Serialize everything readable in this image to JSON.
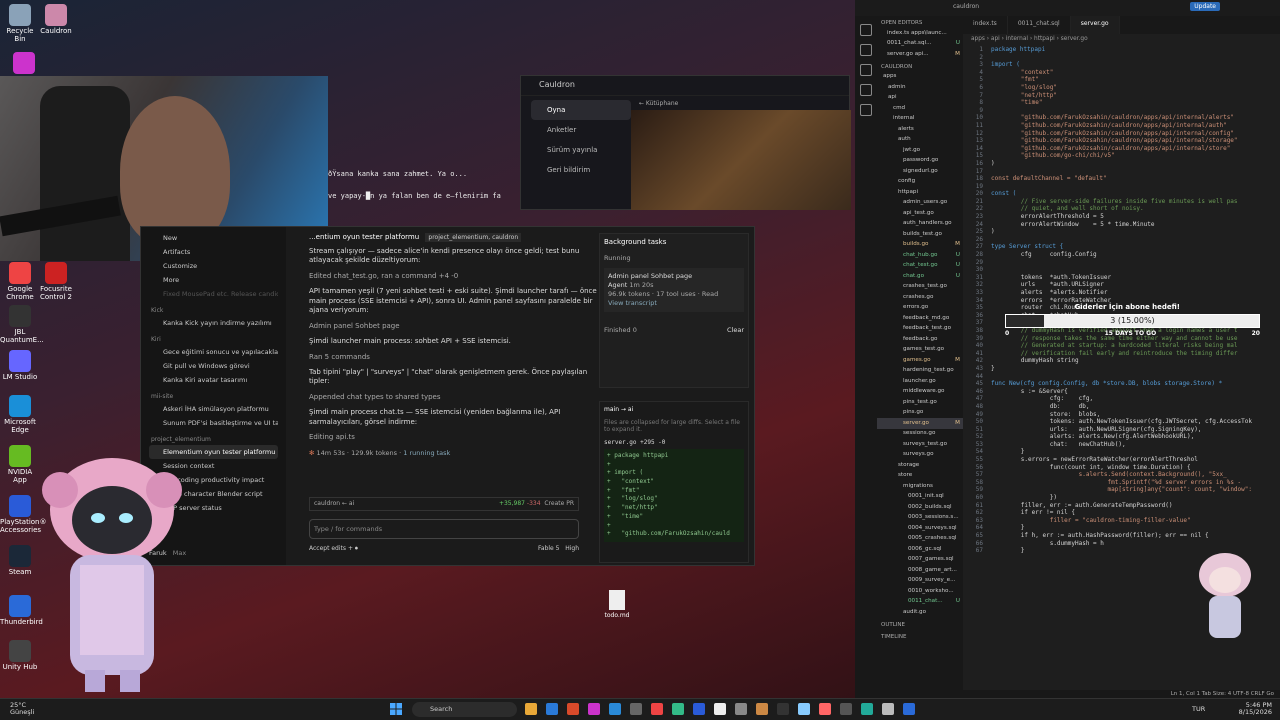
{
  "desktop": {
    "icons": [
      {
        "label": "Recycle Bin",
        "color": "#8aa2b8"
      },
      {
        "label": "Cauldron",
        "color": "#c8a"
      },
      {
        "label": "Google Chrome",
        "color": "#e44"
      },
      {
        "label": "Focusrite Control 2",
        "color": "#c22"
      },
      {
        "label": "JBL QuantumE...",
        "color": "#333"
      },
      {
        "label": "LM Studio",
        "color": "#66f"
      },
      {
        "label": "Microsoft Edge",
        "color": "#1a8fd8"
      },
      {
        "label": "NVIDIA App",
        "color": "#6b2"
      },
      {
        "label": "PlayStation® Accessories",
        "color": "#2a5bd8"
      },
      {
        "label": "Steam",
        "color": "#1b2838"
      },
      {
        "label": "Thunderbird",
        "color": "#2a6ad8"
      },
      {
        "label": "Unity Hub",
        "color": "#444"
      }
    ],
    "file_label": "todo.md"
  },
  "launcher": {
    "title": "Cauldron",
    "nav": [
      "Oyna",
      "Anketler",
      "Sürüm yayınla",
      "Geri bildirim"
    ],
    "breadcrumb": "← Kütüphane"
  },
  "terminal": {
    "line1": "ðŸsana kanka sana zahmet. Ya o...",
    "line2": "ve yapay-█n ya falan ben de e—flenirim fa"
  },
  "claude": {
    "sidebar": {
      "top_items": [
        "New",
        "Artifacts",
        "Customize",
        "More"
      ],
      "faded": "Fixed MousePad etc. Release candidate",
      "sections": [
        {
          "title": "Kick",
          "items": [
            "Kanka Kick yayın indirme yazılımı"
          ]
        },
        {
          "title": "Kiri",
          "items": [
            "Gece eğitimi sonucu ve yapılacaklar",
            "Git pull ve Windows görevi",
            "Kanka Kiri avatar tasarımı"
          ]
        },
        {
          "title": "mii-site",
          "items": [
            "Askeri İHA simülasyon platformu",
            "Sunum PDF'si basitleştirme ve UI ta..."
          ]
        },
        {
          "title": "project_elementium",
          "items": [
            "Elementium oyun tester platformu",
            "Session context",
            "Vibecoding productivity impact",
            "MOSS character Blender script",
            "MCP server status"
          ]
        }
      ],
      "user": "Faruk",
      "plan": "Max"
    },
    "chat": {
      "title": "...entium oyun tester platformu",
      "project_tag": "project_elementium, cauldron",
      "p1": "Stream çalışıyor — sadece alice'in kendi presence olayı önce geldi; test bunu atlayacak şekilde düzeltiyorum:",
      "m1": "Edited chat_test.go, ran a command +4 -0",
      "p2": "API tamamen yeşil (7 yeni sohbet testi + eski suite). Şimdi launcher tarafı — önce main process (SSE istemcisi + API), sonra UI. Admin panel sayfasını paralelde bir ajana veriyorum:",
      "m2": "Admin panel Sohbet page",
      "p3": "Şimdi launcher main process: sohbet API + SSE istemcisi.",
      "m3": "Ran 5 commands",
      "p4": "Tab tipini \"play\" | \"surveys\" | \"chat\" olarak genişletmem gerek. Önce paylaşılan tipler:",
      "m4": "Appended chat types to shared types",
      "p5": "Şimdi main process chat.ts — SSE istemcisi (yeniden bağlanma ile), API sarmalayıcıları, görsel indirme:",
      "m5": "Editing api.ts",
      "stats_time": "14m 53s",
      "stats_tokens": "129.9k tokens",
      "stats_task": "1 running task"
    },
    "input": {
      "branch": "cauldron",
      "sub": "ai",
      "added": "+35,987",
      "removed": "-334",
      "pr": "Create PR",
      "placeholder": "Type / for commands",
      "accept": "Accept edits",
      "model": "Fable 5",
      "effort": "High"
    },
    "tasks": {
      "title": "Background tasks",
      "running": "Running",
      "task_name": "Admin panel Sohbet page",
      "agent": "Agent",
      "duration": "1m 20s",
      "usage": "96.9k tokens · 17 tool uses · Read",
      "transcript": "View transcript",
      "finished": "Finished 0",
      "clear": "Clear"
    },
    "diff": {
      "branch": "main",
      "arrow": "→ ai",
      "note": "Files are collapsed for large diffs. Select a file to expand it.",
      "file": "server.go +295 -0",
      "code": "+ package httpapi\n+\n+ import (\n+   \"context\"\n+   \"fmt\"\n+   \"log/slog\"\n+   \"net/http\"\n+   \"time\"\n+\n+   \"github.com/FarukOzsahin/cauld"
    }
  },
  "vscode": {
    "title": "cauldron",
    "update": "Update",
    "tabs": [
      "index.ts",
      "0011_chat.sql",
      "server.go"
    ],
    "breadcrumb": "apps › api › internal › httpapi › server.go",
    "explorer": {
      "open_editors": "OPEN EDITORS",
      "open_files": [
        {
          "name": "index.ts apps\\launc...",
          "flag": ""
        },
        {
          "name": "0011_chat.sql...",
          "flag": "U"
        },
        {
          "name": "server.go api...",
          "flag": "M"
        }
      ],
      "root": "CAULDRON",
      "tree": [
        {
          "name": "apps",
          "flag": "",
          "depth": 0
        },
        {
          "name": "admin",
          "flag": "",
          "depth": 1
        },
        {
          "name": "api",
          "flag": "",
          "depth": 1
        },
        {
          "name": "cmd",
          "flag": "",
          "depth": 2
        },
        {
          "name": "internal",
          "flag": "",
          "depth": 2
        },
        {
          "name": "alerts",
          "flag": "",
          "depth": 3
        },
        {
          "name": "auth",
          "flag": "",
          "depth": 3
        },
        {
          "name": "jwt.go",
          "flag": "",
          "depth": 4
        },
        {
          "name": "password.go",
          "flag": "",
          "depth": 4
        },
        {
          "name": "signedurl.go",
          "flag": "",
          "depth": 4
        },
        {
          "name": "config",
          "flag": "",
          "depth": 3
        },
        {
          "name": "httpapi",
          "flag": "",
          "depth": 3
        },
        {
          "name": "admin_users.go",
          "flag": "",
          "depth": 4
        },
        {
          "name": "api_test.go",
          "flag": "",
          "depth": 4
        },
        {
          "name": "auth_handlers.go",
          "flag": "",
          "depth": 4
        },
        {
          "name": "builds_test.go",
          "flag": "",
          "depth": 4
        },
        {
          "name": "builds.go",
          "flag": "M",
          "depth": 4
        },
        {
          "name": "chat_hub.go",
          "flag": "U",
          "depth": 4
        },
        {
          "name": "chat_test.go",
          "flag": "U",
          "depth": 4
        },
        {
          "name": "chat.go",
          "flag": "U",
          "depth": 4
        },
        {
          "name": "crashes_test.go",
          "flag": "",
          "depth": 4
        },
        {
          "name": "crashes.go",
          "flag": "",
          "depth": 4
        },
        {
          "name": "errors.go",
          "flag": "",
          "depth": 4
        },
        {
          "name": "feedback_md.go",
          "flag": "",
          "depth": 4
        },
        {
          "name": "feedback_test.go",
          "flag": "",
          "depth": 4
        },
        {
          "name": "feedback.go",
          "flag": "",
          "depth": 4
        },
        {
          "name": "games_test.go",
          "flag": "",
          "depth": 4
        },
        {
          "name": "games.go",
          "flag": "M",
          "depth": 4
        },
        {
          "name": "hardening_test.go",
          "flag": "",
          "depth": 4
        },
        {
          "name": "launcher.go",
          "flag": "",
          "depth": 4
        },
        {
          "name": "middleware.go",
          "flag": "",
          "depth": 4
        },
        {
          "name": "pins_test.go",
          "flag": "",
          "depth": 4
        },
        {
          "name": "pins.go",
          "flag": "",
          "depth": 4
        },
        {
          "name": "server.go",
          "flag": "M",
          "depth": 4
        },
        {
          "name": "sessions.go",
          "flag": "",
          "depth": 4
        },
        {
          "name": "surveys_test.go",
          "flag": "",
          "depth": 4
        },
        {
          "name": "surveys.go",
          "flag": "",
          "depth": 4
        },
        {
          "name": "storage",
          "flag": "",
          "depth": 3
        },
        {
          "name": "store",
          "flag": "",
          "depth": 3
        },
        {
          "name": "migrations",
          "flag": "",
          "depth": 4
        },
        {
          "name": "0001_init.sql",
          "flag": "",
          "depth": 5
        },
        {
          "name": "0002_builds.sql",
          "flag": "",
          "depth": 5
        },
        {
          "name": "0003_sessions.s...",
          "flag": "",
          "depth": 5
        },
        {
          "name": "0004_surveys.sql",
          "flag": "",
          "depth": 5
        },
        {
          "name": "0005_crashes.sql",
          "flag": "",
          "depth": 5
        },
        {
          "name": "0006_gc.sql",
          "flag": "",
          "depth": 5
        },
        {
          "name": "0007_games.sql",
          "flag": "",
          "depth": 5
        },
        {
          "name": "0008_game_art...",
          "flag": "",
          "depth": 5
        },
        {
          "name": "0009_survey_e...",
          "flag": "",
          "depth": 5
        },
        {
          "name": "0010_worksho...",
          "flag": "",
          "depth": 5
        },
        {
          "name": "0011_chat...",
          "flag": "U",
          "depth": 5
        },
        {
          "name": "audit.go",
          "flag": "",
          "depth": 4
        }
      ],
      "outline": "OUTLINE",
      "timeline": "TIMELINE"
    },
    "code": [
      "package httpapi",
      "",
      "import (",
      "\t\"context\"",
      "\t\"fmt\"",
      "\t\"log/slog\"",
      "\t\"net/http\"",
      "\t\"time\"",
      "",
      "\t\"github.com/FarukOzsahin/cauldron/apps/api/internal/alerts\"",
      "\t\"github.com/FarukOzsahin/cauldron/apps/api/internal/auth\"",
      "\t\"github.com/FarukOzsahin/cauldron/apps/api/internal/config\"",
      "\t\"github.com/FarukOzsahin/cauldron/apps/api/internal/storage\"",
      "\t\"github.com/FarukOzsahin/cauldron/apps/api/internal/store\"",
      "\t\"github.com/go-chi/chi/v5\"",
      ")",
      "",
      "const defaultChannel = \"default\"",
      "",
      "const (",
      "\t// Five server-side failures inside five minutes is well pas",
      "\t// quiet, and well short of noisy.",
      "\terrorAlertThreshold = 5",
      "\terrorAlertWindow    = 5 * time.Minute",
      ")",
      "",
      "type Server struct {",
      "\tcfg     config.Config",
      "",
      "",
      "\ttokens  *auth.TokenIssuer",
      "\turls    *auth.URLSigner",
      "\talerts  *alerts.Notifier",
      "\terrors  *errorRateWatcher",
      "\trouter  chi.Router",
      "\tchat    *chatHub",
      "",
      "\t// dummyHash is verified against when a login names a user t",
      "\t// response takes the same time either way and cannot be use",
      "\t// Generated at startup: a hardcoded literal risks being mal",
      "\t// verification fail early and reintroduce the timing differ",
      "\tdummyHash string",
      "}",
      "",
      "func New(cfg config.Config, db *store.DB, blobs storage.Store) *",
      "\ts := &Server{",
      "\t\tcfg:    cfg,",
      "\t\tdb:     db,",
      "\t\tstore:  blobs,",
      "\t\ttokens: auth.NewTokenIssuer(cfg.JWTSecret, cfg.AccessTok",
      "\t\turls:   auth.NewURLSigner(cfg.SigningKey),",
      "\t\talerts: alerts.New(cfg.AlertWebhookURL),",
      "\t\tchat:   newChatHub(),",
      "\t}",
      "\ts.errors = newErrorRateWatcher(errorAlertThreshol",
      "\t\tfunc(count int, window time.Duration) {",
      "\t\t\ts.alerts.Send(context.Background(), \"5xx_",
      "\t\t\t\tfmt.Sprintf(\"%d server errors in %s -",
      "\t\t\t\tmap[string]any{\"count\": count, \"window\":",
      "\t\t})",
      "\tfiller, err := auth.GenerateTempPassword()",
      "\tif err != nil {",
      "\t\tfiller = \"cauldron-timing-filler-value\"",
      "\t}",
      "\tif h, err := auth.HashPassword(filler); err == nil {",
      "\t\ts.dummyHash = h",
      "\t}"
    ],
    "status": "Ln 1, Col 1   Tab Size: 4   UTF-8   CRLF   Go"
  },
  "goal": {
    "title": "Giderler İçin abone hedefi!",
    "progress_text": "3 (15.00%)",
    "progress": 0.15,
    "left_value": "0",
    "days": "15 DAYS TO GO",
    "target": "20"
  },
  "taskbar": {
    "temp": "25°C",
    "weather": "Güneşli",
    "search": "Search",
    "lang": "TUR",
    "time": "5:46 PM",
    "date": "8/15/2026",
    "app_colors": [
      "#e8a838",
      "#2a7ad8",
      "#d84a2a",
      "#c3c",
      "#2a8ad8",
      "#666",
      "#e44",
      "#3b8",
      "#2a5bd8",
      "#eee",
      "#888",
      "#c84",
      "#333",
      "#8cf",
      "#f66",
      "#555",
      "#2a9",
      "#bbb",
      "#2a6ad8"
    ]
  }
}
